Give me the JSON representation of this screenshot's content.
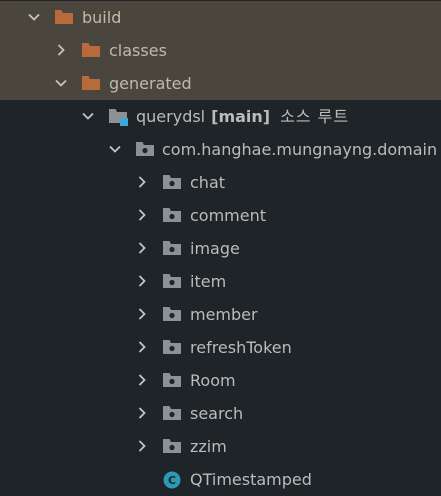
{
  "colors": {
    "background": "#1f2428",
    "excluded_row_background": "#4a463e",
    "folder_orange": "#b86a3d",
    "folder_gray": "#8c9196",
    "source_root_badge": "#3fa7d6",
    "class_icon": "#2a9bb4",
    "text": "#bbbbbb"
  },
  "tree": {
    "build": {
      "label": "build",
      "icon": "folder-excluded-icon",
      "arrow": "chevron-down-icon"
    },
    "classes": {
      "label": "classes",
      "icon": "folder-excluded-icon",
      "arrow": "chevron-right-icon"
    },
    "generated": {
      "label": "generated",
      "icon": "folder-excluded-icon",
      "arrow": "chevron-down-icon"
    },
    "querydsl": {
      "label": "querydsl",
      "branch": "[main]",
      "root_tag": "소스 루트",
      "icon": "source-root-folder-icon",
      "arrow": "chevron-down-icon"
    },
    "domain_package": {
      "label": "com.hanghae.mungnayng.domain",
      "icon": "package-icon",
      "arrow": "chevron-down-icon"
    },
    "packages": [
      {
        "label": "chat"
      },
      {
        "label": "comment"
      },
      {
        "label": "image"
      },
      {
        "label": "item"
      },
      {
        "label": "member"
      },
      {
        "label": "refreshToken"
      },
      {
        "label": "Room"
      },
      {
        "label": "search"
      },
      {
        "label": "zzim"
      }
    ],
    "class_file": {
      "label": "QTimestamped",
      "icon_letter": "C"
    }
  }
}
